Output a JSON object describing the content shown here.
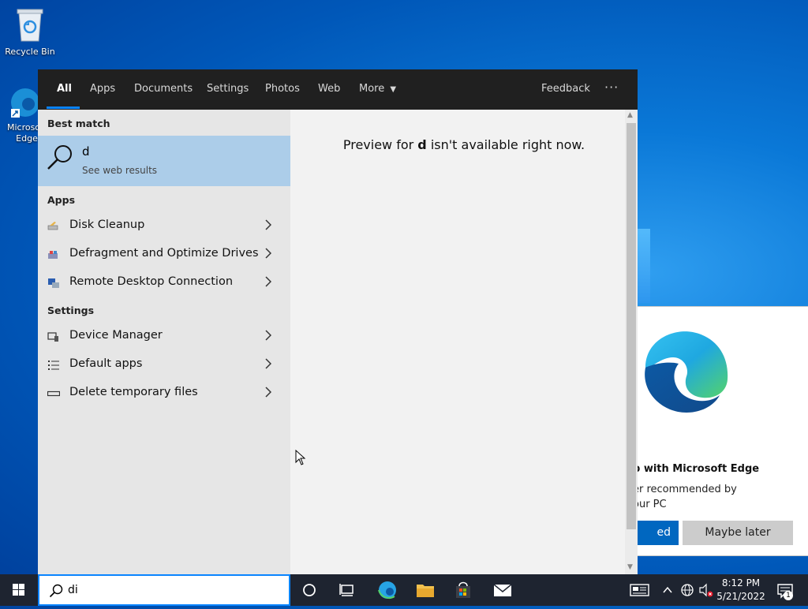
{
  "desktop": {
    "icons": [
      {
        "label": "Recycle Bin"
      },
      {
        "label": "Microsoft Edge"
      }
    ]
  },
  "search": {
    "tabs": [
      "All",
      "Apps",
      "Documents",
      "Settings",
      "Photos",
      "Web",
      "More"
    ],
    "feedback": "Feedback",
    "more_dots": "···",
    "best_match_header": "Best match",
    "best_match": {
      "query": "d",
      "sub": "See web results"
    },
    "apps_header": "Apps",
    "apps": [
      {
        "label": "Disk Cleanup",
        "icon": "disk-cleanup-icon"
      },
      {
        "label": "Defragment and Optimize Drives",
        "icon": "defragment-icon"
      },
      {
        "label": "Remote Desktop Connection",
        "icon": "remote-desktop-icon"
      }
    ],
    "settings_header": "Settings",
    "settings": [
      {
        "label": "Device Manager",
        "icon": "device-manager-icon"
      },
      {
        "label": "Default apps",
        "icon": "default-apps-icon"
      },
      {
        "label": "Delete temporary files",
        "icon": "storage-icon"
      }
    ],
    "preview": {
      "pre": "Preview for ",
      "term": "d",
      "post": " isn't available right now."
    },
    "input_value": "di"
  },
  "promo": {
    "title": "b with Microsoft Edge",
    "body_line1": "er recommended by",
    "body_line2": "our PC",
    "primary_button": "ed",
    "secondary_button": "Maybe later"
  },
  "tray": {
    "time": "8:12 PM",
    "date": "5/21/2022",
    "notification_count": "1"
  },
  "colors": {
    "accent": "#0a84ff",
    "best_match_bg": "#accde9",
    "taskbar": "#1e2430",
    "edge_button": "#0067c0"
  }
}
